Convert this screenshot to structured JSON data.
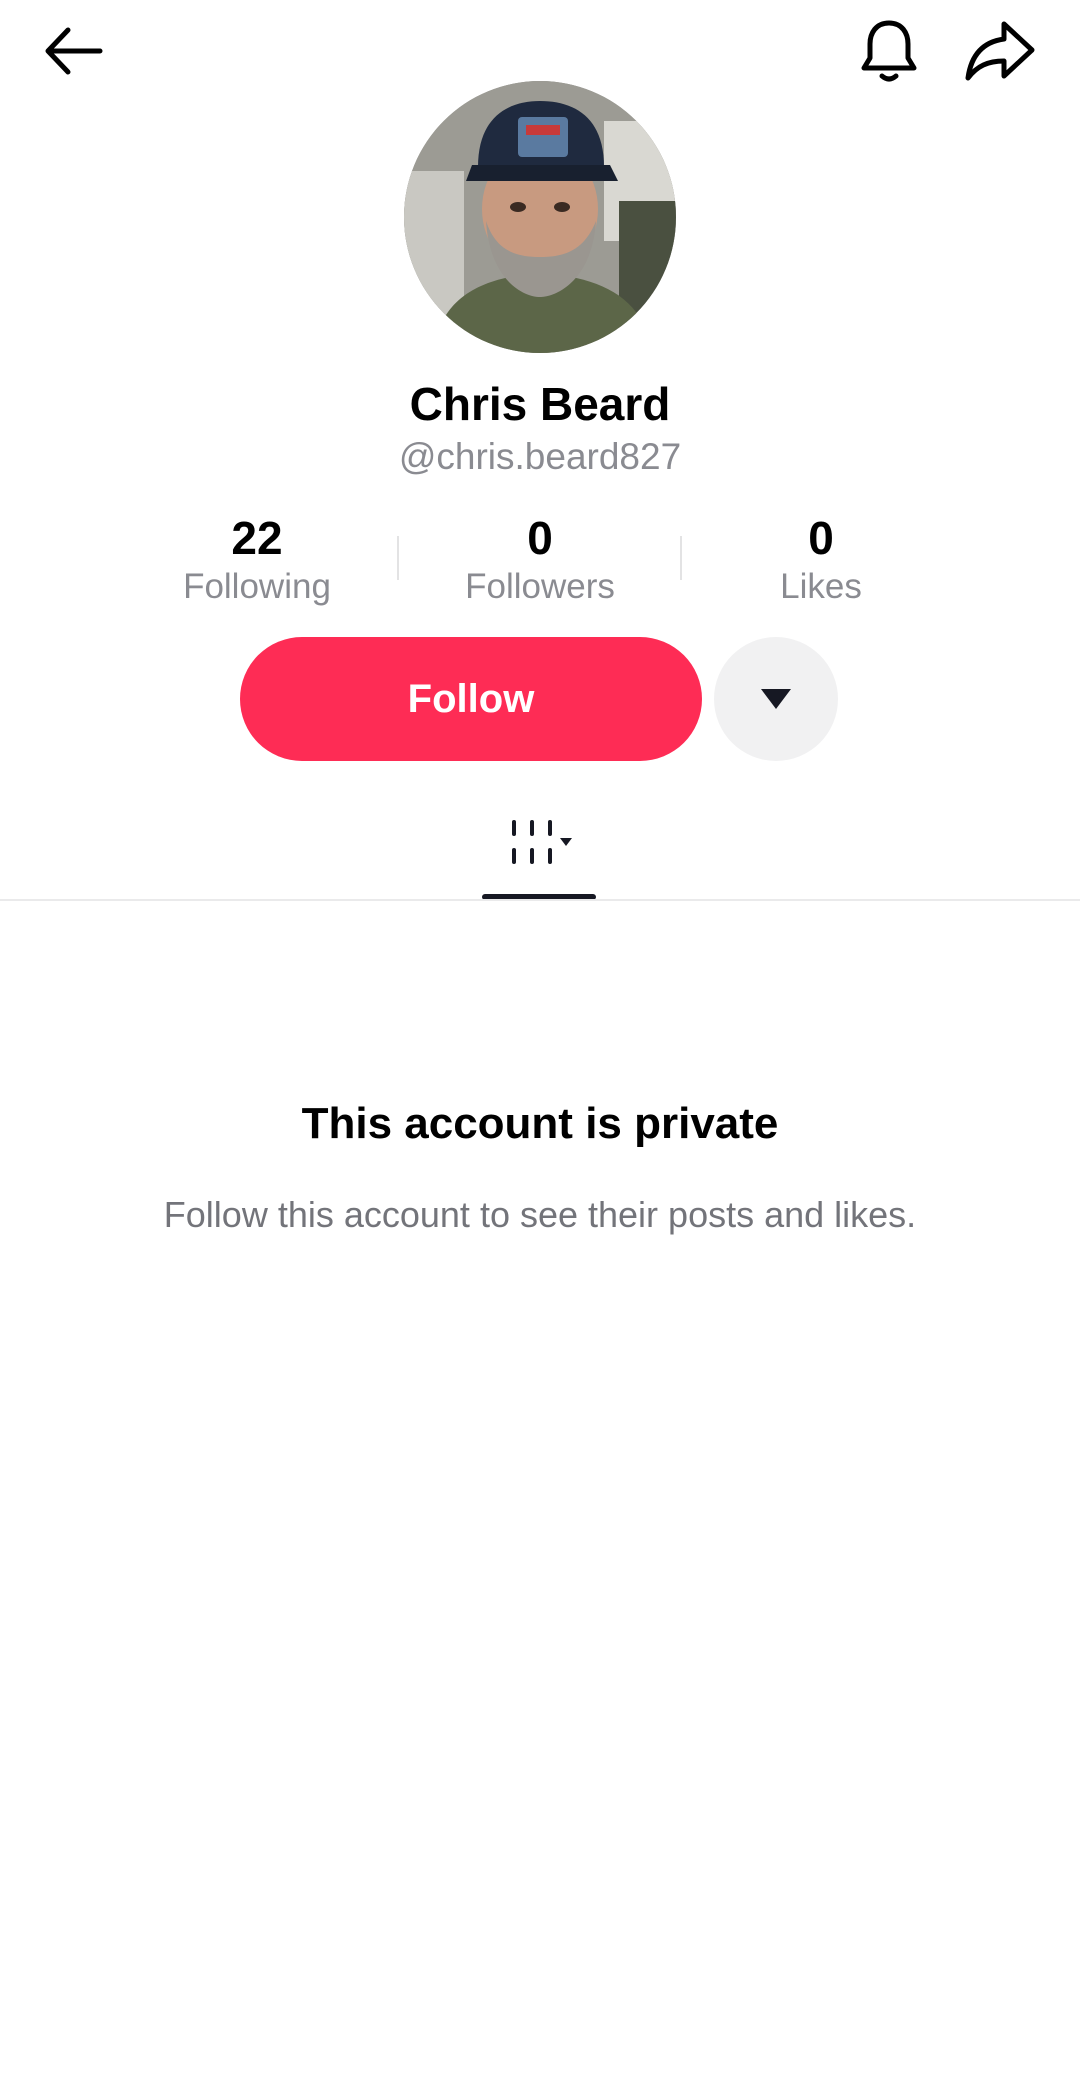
{
  "header": {
    "back_icon": "back-arrow-icon",
    "notification_icon": "bell-icon",
    "share_icon": "share-arrow-icon"
  },
  "profile": {
    "display_name": "Chris Beard",
    "username": "@chris.beard827",
    "avatar_icon": "avatar-photo"
  },
  "stats": [
    {
      "value": "22",
      "label": "Following"
    },
    {
      "value": "0",
      "label": "Followers"
    },
    {
      "value": "0",
      "label": "Likes"
    }
  ],
  "actions": {
    "follow_label": "Follow",
    "more_icon": "caret-down-icon"
  },
  "tabs": {
    "active_icon": "videos-grid-icon"
  },
  "private_notice": {
    "title": "This account is private",
    "message": "Follow this account to see their posts and likes."
  },
  "colors": {
    "accent": "#fe2c55",
    "secondary_text": "#8a8b91",
    "background": "#ffffff"
  }
}
